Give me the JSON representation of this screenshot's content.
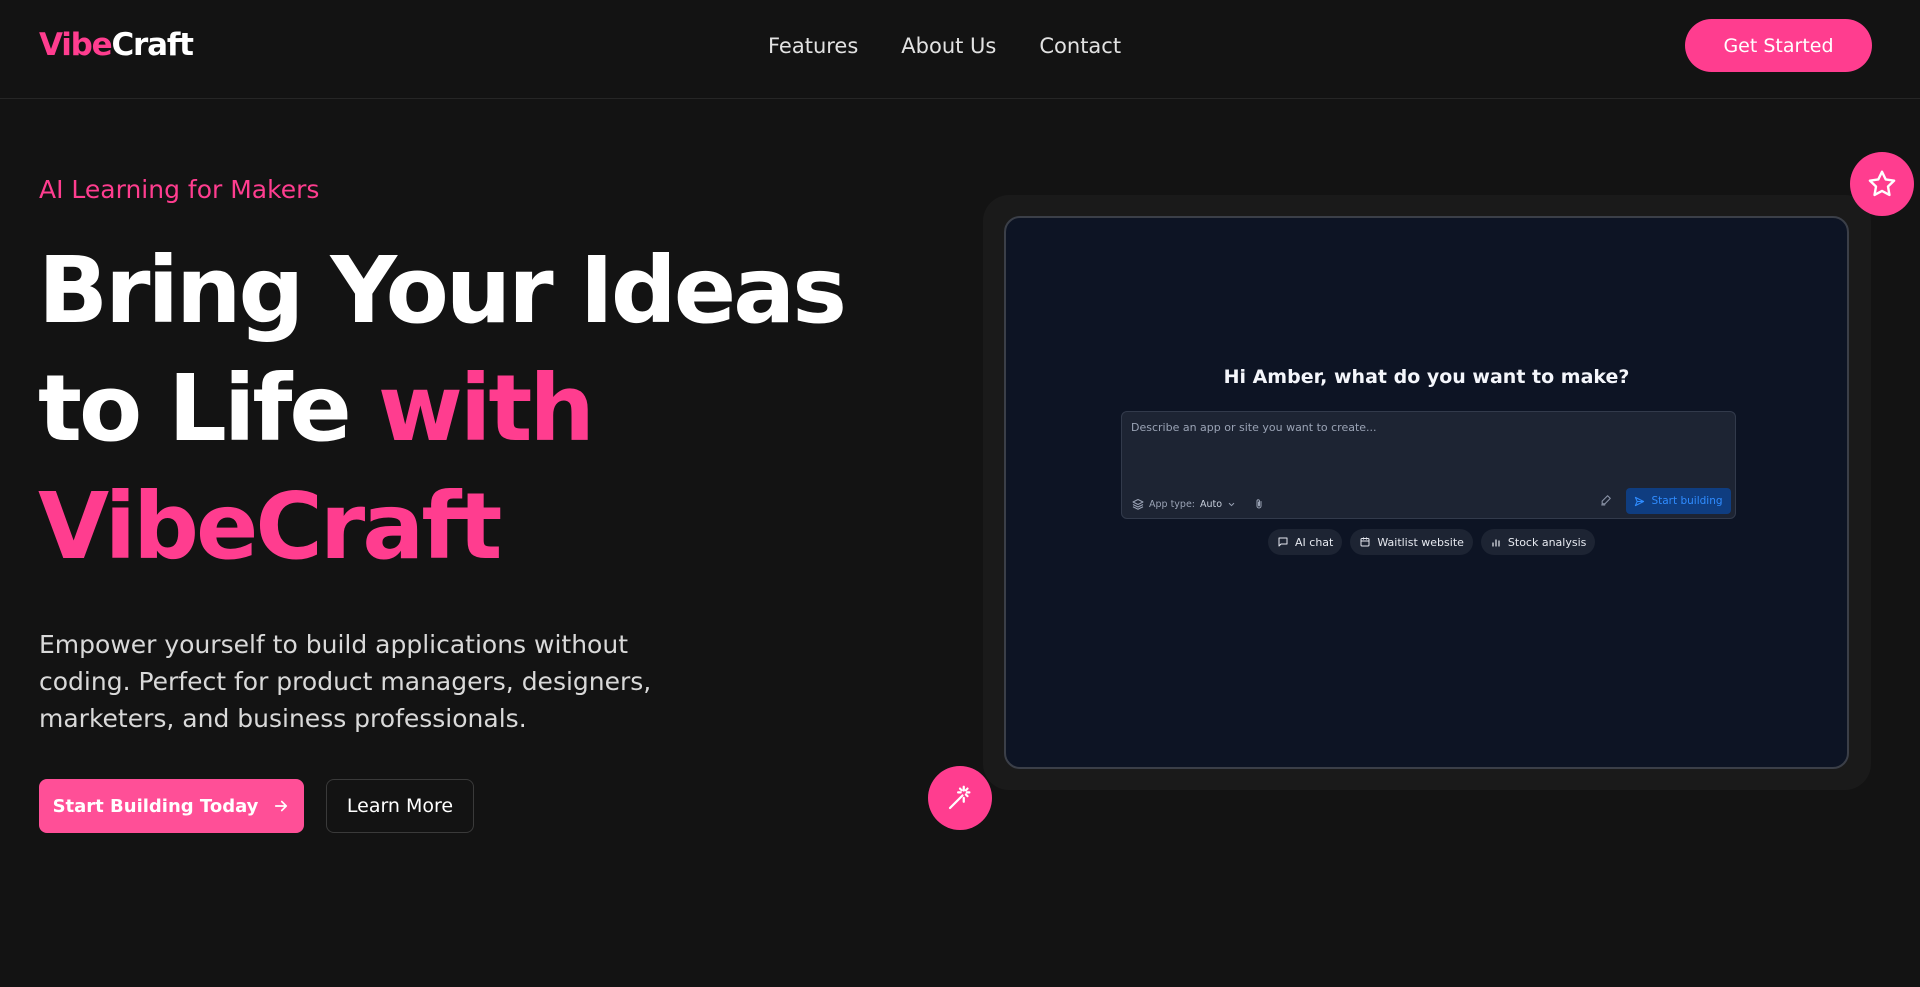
{
  "brand": {
    "logo_part1": "Vibe",
    "logo_part2": "Craft",
    "accent": "#ff3d8f",
    "background": "#131313"
  },
  "nav": {
    "items": [
      {
        "label": "Features"
      },
      {
        "label": "About Us"
      },
      {
        "label": "Contact"
      }
    ]
  },
  "header": {
    "cta_label": "Get Started"
  },
  "hero": {
    "eyebrow": "AI Learning for Makers",
    "headline_line1": "Bring Your Ideas",
    "headline_line2_white": "to Life ",
    "headline_line2_pink": "with",
    "headline_line3_pink": "VibeCraft",
    "subtext": "Empower yourself to build applications without coding. Perfect for product managers, designers, marketers, and business professionals.",
    "primary_button": "Start Building Today",
    "secondary_button": "Learn More"
  },
  "preview": {
    "greeting": "Hi Amber, what do you want to make?",
    "prompt_placeholder": "Describe an app or site you want to create...",
    "app_type_label": "App type:",
    "app_type_value": "Auto",
    "start_button": "Start building",
    "chips": [
      {
        "label": "AI chat",
        "icon": "chat-icon"
      },
      {
        "label": "Waitlist website",
        "icon": "calendar-icon"
      },
      {
        "label": "Stock analysis",
        "icon": "bar-chart-icon"
      }
    ]
  },
  "icons": {
    "fab_top": "star-icon",
    "fab_bottom": "magic-wand-icon",
    "primary_button": "arrow-right-icon"
  }
}
